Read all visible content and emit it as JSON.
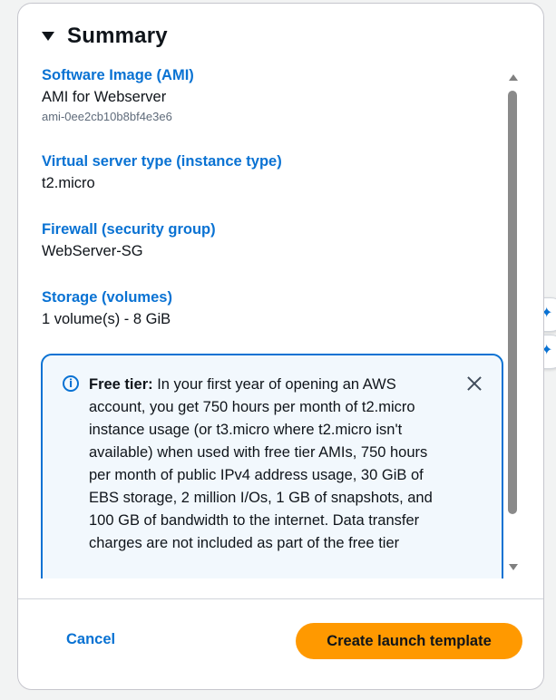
{
  "summary": {
    "title": "Summary",
    "items": [
      {
        "label": "Software Image (AMI)",
        "value": "AMI for Webserver",
        "sub": "ami-0ee2cb10b8bf4e3e6"
      },
      {
        "label": "Virtual server type (instance type)",
        "value": "t2.micro"
      },
      {
        "label": "Firewall (security group)",
        "value": "WebServer-SG"
      },
      {
        "label": "Storage (volumes)",
        "value": "1 volume(s) - 8 GiB"
      }
    ],
    "alert": {
      "icon": "info-icon",
      "bold": "Free tier:",
      "text": " In your first year of opening an AWS account, you get 750 hours per month of t2.micro instance usage (or t3.micro where t2.micro isn't available) when used with free tier AMIs, 750 hours per month of public IPv4 address usage, 30 GiB of EBS storage, 2 million I/Os, 1 GB of snapshots, and 100 GB of bandwidth to the internet. Data transfer charges are not included as part of the free tier"
    }
  },
  "footer": {
    "cancel_label": "Cancel",
    "create_label": "Create launch template"
  },
  "colors": {
    "accent": "#0972d3",
    "primary": "#ff9900",
    "alert_bg": "#f2f8fd"
  },
  "side_tools": [
    {
      "icon": "sparkle-icon",
      "glyph": "✦"
    },
    {
      "icon": "droplet-sparkle-icon",
      "glyph": "✦"
    }
  ]
}
